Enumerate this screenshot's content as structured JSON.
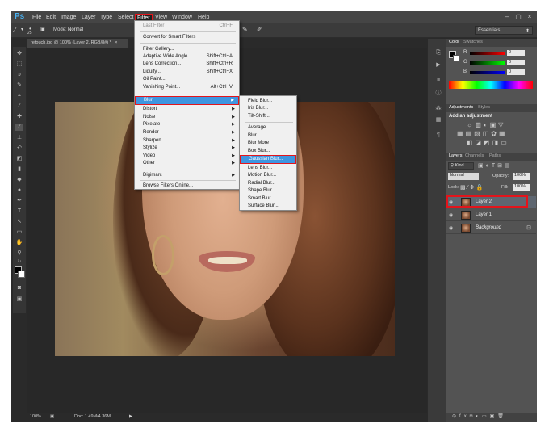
{
  "app": {
    "logo": "Ps",
    "menu": [
      "File",
      "Edit",
      "Image",
      "Layer",
      "Type",
      "Select",
      "Filter",
      "View",
      "Window",
      "Help"
    ],
    "active_menu": "Filter",
    "window_controls": [
      "–",
      "▢",
      "×"
    ]
  },
  "options": {
    "brush_size": "25",
    "mode_label": "Mode:",
    "mode_value": "Normal",
    "workspace": "Essentials"
  },
  "document": {
    "tab_title": "retouch.jpg @ 100% (Layer 2, RGB/8#) *",
    "tab_close": "×",
    "zoom": "100%",
    "doc_info": "Doc: 1.49M/4.36M"
  },
  "filter_menu": {
    "items": [
      {
        "label": "Last Filter",
        "shortcut": "Ctrl+F",
        "disabled": true
      },
      {
        "label": "Convert for Smart Filters",
        "shortcut": ""
      },
      {
        "label": "Filter Gallery...",
        "shortcut": ""
      },
      {
        "label": "Adaptive Wide Angle...",
        "shortcut": "Shift+Ctrl+A"
      },
      {
        "label": "Lens Correction...",
        "shortcut": "Shift+Ctrl+R"
      },
      {
        "label": "Liquify...",
        "shortcut": "Shift+Ctrl+X"
      },
      {
        "label": "Oil Paint...",
        "shortcut": ""
      },
      {
        "label": "Vanishing Point...",
        "shortcut": "Alt+Ctrl+V"
      },
      {
        "label": "Blur",
        "submenu": true
      },
      {
        "label": "Distort",
        "submenu": true
      },
      {
        "label": "Noise",
        "submenu": true
      },
      {
        "label": "Pixelate",
        "submenu": true
      },
      {
        "label": "Render",
        "submenu": true
      },
      {
        "label": "Sharpen",
        "submenu": true
      },
      {
        "label": "Stylize",
        "submenu": true
      },
      {
        "label": "Video",
        "submenu": true
      },
      {
        "label": "Other",
        "submenu": true
      },
      {
        "label": "Digimarc",
        "submenu": true
      },
      {
        "label": "Browse Filters Online...",
        "shortcut": ""
      }
    ],
    "highlighted": "Blur"
  },
  "blur_submenu": {
    "items": [
      "Field Blur...",
      "Iris Blur...",
      "Tilt-Shift...",
      "Average",
      "Blur",
      "Blur More",
      "Box Blur...",
      "Gaussian Blur...",
      "Lens Blur...",
      "Motion Blur...",
      "Radial Blur...",
      "Shape Blur...",
      "Smart Blur...",
      "Surface Blur..."
    ],
    "highlighted": "Gaussian Blur..."
  },
  "color_panel": {
    "tabs": [
      "Color",
      "Swatches"
    ],
    "channels": [
      {
        "label": "R",
        "value": "0",
        "color": "#d02020"
      },
      {
        "label": "G",
        "value": "0",
        "color": "#20b030"
      },
      {
        "label": "B",
        "value": "0",
        "color": "#2050d0"
      }
    ]
  },
  "adjustments_panel": {
    "tabs": [
      "Adjustments",
      "Styles"
    ],
    "heading": "Add an adjustment"
  },
  "layers_panel": {
    "tabs": [
      "Layers",
      "Channels",
      "Paths"
    ],
    "filter_kind": "Kind",
    "blend_mode": "Normal",
    "opacity_label": "Opacity:",
    "opacity_value": "100%",
    "lock_label": "Lock:",
    "fill_label": "Fill:",
    "fill_value": "100%",
    "layers": [
      {
        "name": "Layer 2",
        "selected": true
      },
      {
        "name": "Layer 1",
        "selected": false
      },
      {
        "name": "Background",
        "selected": false,
        "locked": true
      }
    ]
  },
  "colors": {
    "menu_highlight": "#3e95e0",
    "callout_red": "#e3141b"
  }
}
